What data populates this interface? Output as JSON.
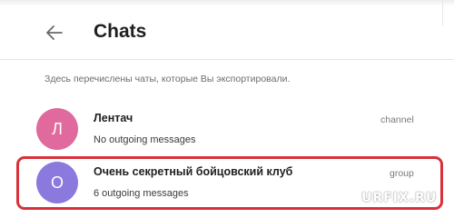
{
  "header": {
    "title": "Chats",
    "back_icon": "arrow-left-icon"
  },
  "description": "Здесь перечислены чаты, которые Вы экспортировали.",
  "chats": [
    {
      "avatar_letter": "Л",
      "avatar_color": "#e06a9d",
      "name": "Лентач",
      "subtitle": "No outgoing messages",
      "type": "channel"
    },
    {
      "avatar_letter": "О",
      "avatar_color": "#8c79de",
      "name": "Очень секретный бойцовский клуб",
      "subtitle": "6 outgoing messages",
      "type": "group",
      "highlighted": true
    }
  ],
  "highlight_color": "#d8313a",
  "watermark": "URFIX.RU"
}
